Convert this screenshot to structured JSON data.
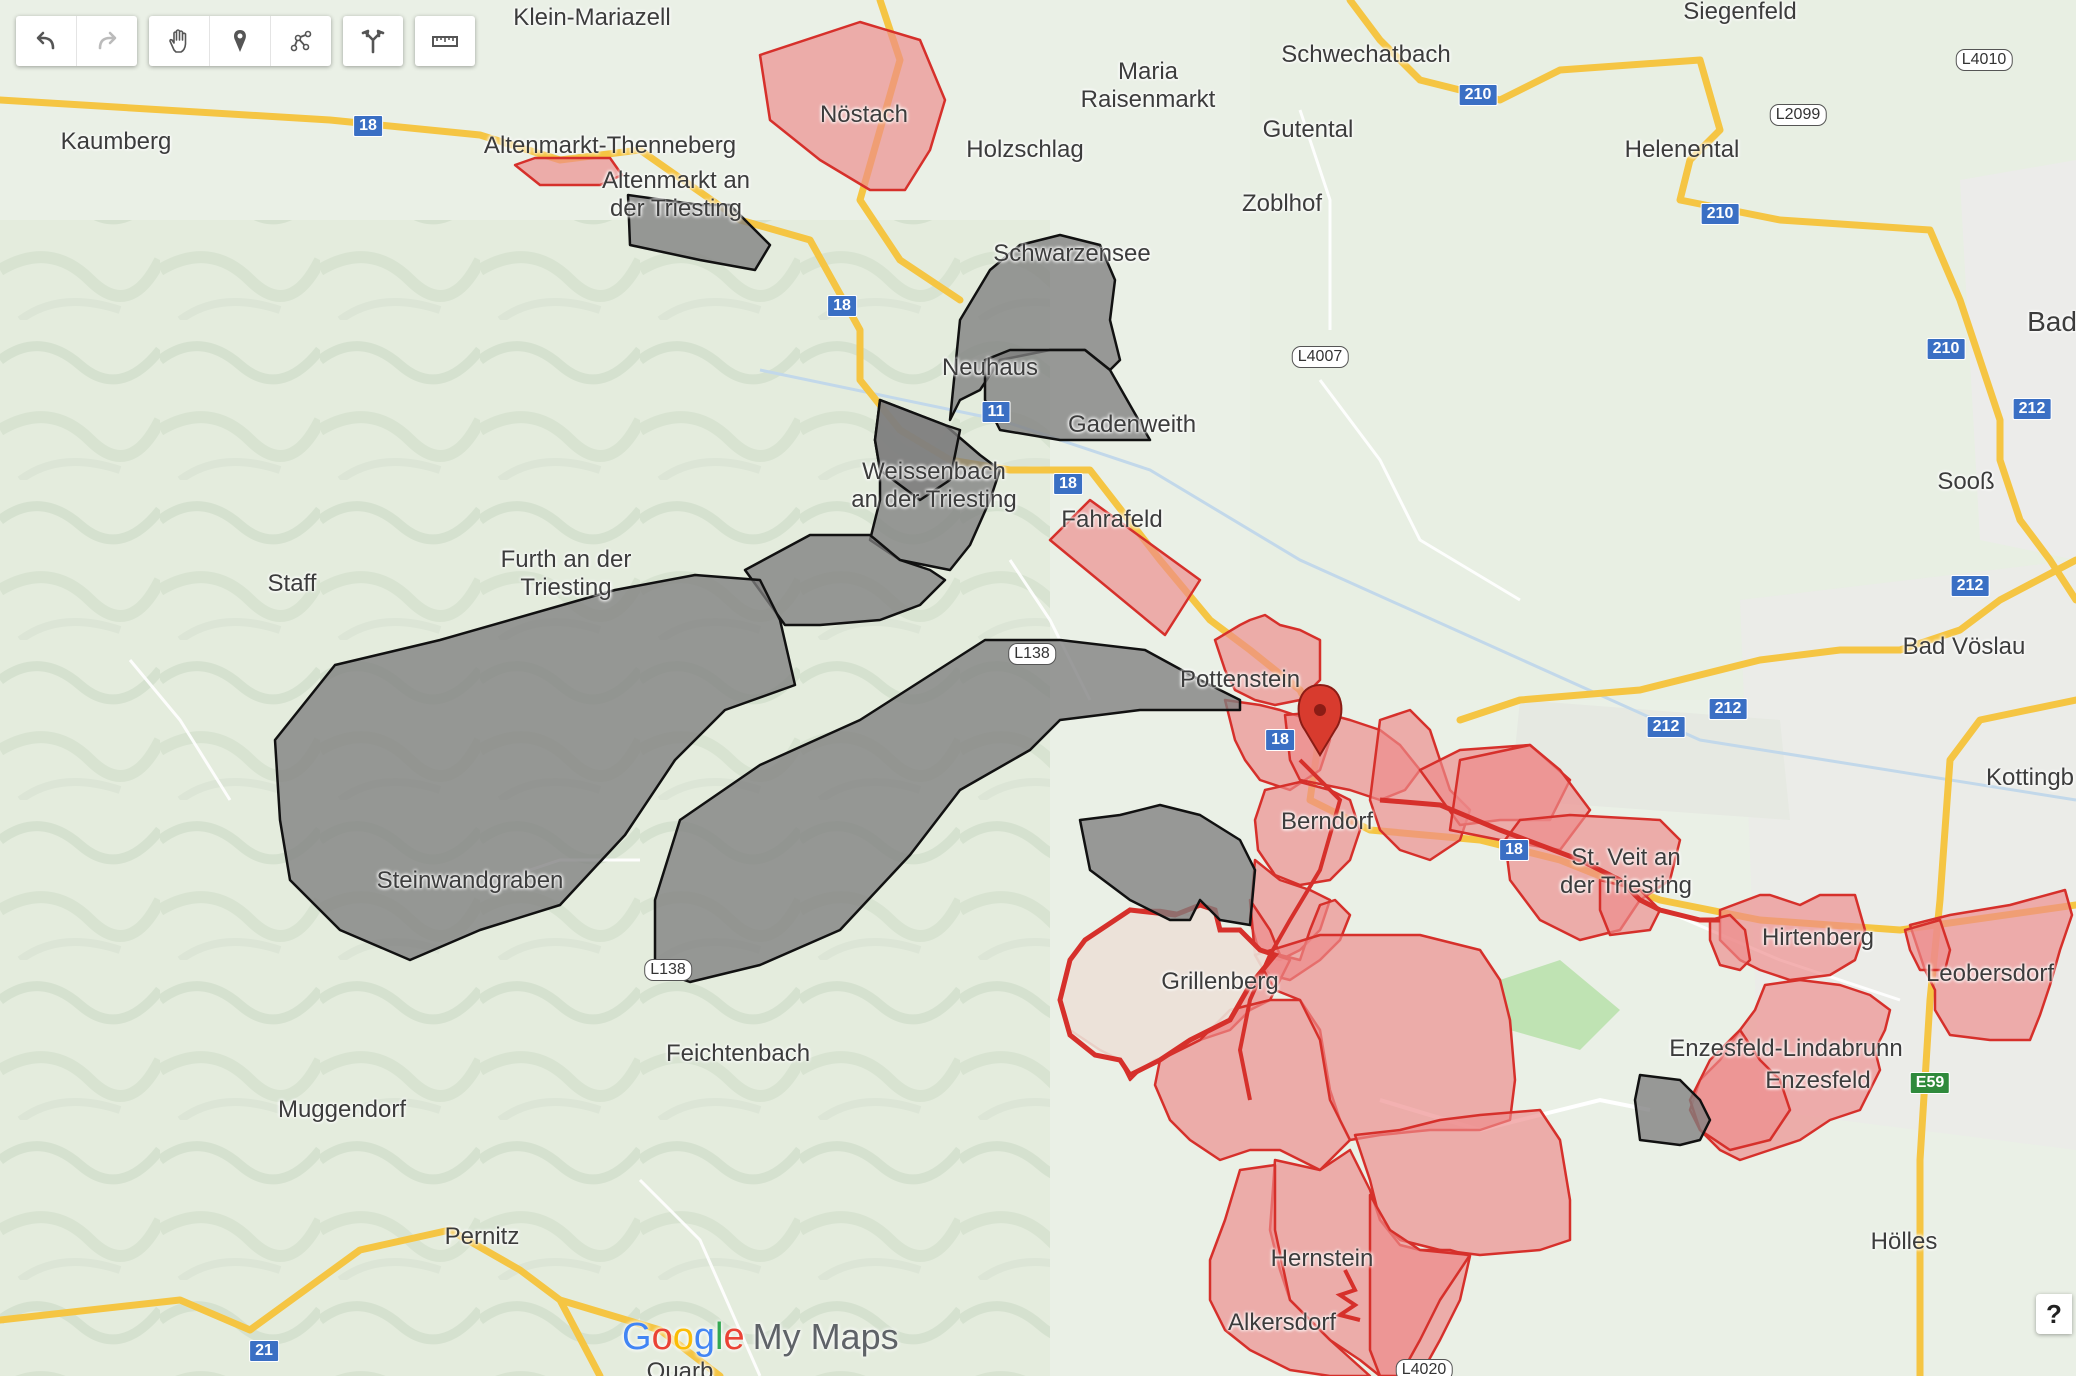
{
  "app": {
    "name_parts": [
      "G",
      "o",
      "o",
      "g",
      "l",
      "e"
    ],
    "suffix": "My Maps",
    "help_label": "?"
  },
  "toolbar": [
    {
      "group": "history",
      "buttons": [
        {
          "icon": "undo-icon",
          "label": "Undo"
        },
        {
          "icon": "redo-icon",
          "label": "Redo"
        }
      ]
    },
    {
      "group": "tools",
      "buttons": [
        {
          "icon": "hand-icon",
          "label": "Select items"
        },
        {
          "icon": "marker-icon",
          "label": "Add marker"
        },
        {
          "icon": "draw-line-icon",
          "label": "Draw a line"
        }
      ]
    },
    {
      "group": "directions",
      "buttons": [
        {
          "icon": "directions-icon",
          "label": "Add directions"
        }
      ]
    },
    {
      "group": "measure",
      "buttons": [
        {
          "icon": "ruler-icon",
          "label": "Measure distances and areas"
        }
      ]
    }
  ],
  "colors": {
    "red_fill": "#ee8c8c",
    "red_stroke": "#d6302b",
    "gray_fill": "#8a8a8a",
    "gray_stroke": "#111111",
    "land": "#e9efe4",
    "road": "#f8d06a"
  },
  "places": {
    "klein_mariazell": "Klein-Mariazell",
    "siegenfeld": "Siegenfeld",
    "schwechatbach": "Schwechatbach",
    "maria_raisenmarkt": "Maria\nRaisenmarkt",
    "kaumberg": "Kaumberg",
    "altenmarkt_thenneberg": "Altenmarkt-Thenneberg",
    "altenmarkt_an_der_triesting": "Altenmarkt an\nder Triesting",
    "noestach": "Nöstach",
    "holzschlag": "Holzschlag",
    "gutental": "Gutental",
    "helenental": "Helenental",
    "zoblhof": "Zoblhof",
    "schwarzensee": "Schwarzensee",
    "neuhaus": "Neuhaus",
    "gadenweith": "Gadenweith",
    "baden": "Bad",
    "weissenbach": "Weissenbach\nan der Triesting",
    "fahrafeld": "Fahrafeld",
    "sooss": "Sooß",
    "staff": "Staff",
    "furth": "Furth an der\nTriesting",
    "bad_voeslau": "Bad Vöslau",
    "pottenstein": "Pottenstein",
    "kottingbrunn": "Kottingb",
    "berndorf": "Berndorf",
    "st_veit": "St. Veit an\nder Triesting",
    "hirtenberg": "Hirtenberg",
    "steinwandgraben": "Steinwandgraben",
    "leobersdorf": "Leobersdorf",
    "grillenberg": "Grillenberg",
    "enzesfeld_lindabrunn": "Enzesfeld-Lindabrunn",
    "enzesfeld": "Enzesfeld",
    "feichtenbach": "Feichtenbach",
    "muggendorf": "Muggendorf",
    "hernstein": "Hernstein",
    "hoelles": "Hölles",
    "pernitz": "Pernitz",
    "alkersdorf": "Alkersdorf",
    "quarb": "Quarb"
  },
  "shields": {
    "r18_a": "18",
    "r18_b": "18",
    "r18_c": "18",
    "r18_d": "18",
    "r18_e": "18",
    "r11": "11",
    "r210_a": "210",
    "r210_b": "210",
    "r210_c": "210",
    "r212_a": "212",
    "r212_b": "212",
    "r212_c": "212",
    "r212_d": "212",
    "r21": "21",
    "l4010": "L4010",
    "l2099": "L2099",
    "l4007": "L4007",
    "l138_a": "L138",
    "l138_b": "L138",
    "l4020": "L4020",
    "e59": "E59"
  }
}
